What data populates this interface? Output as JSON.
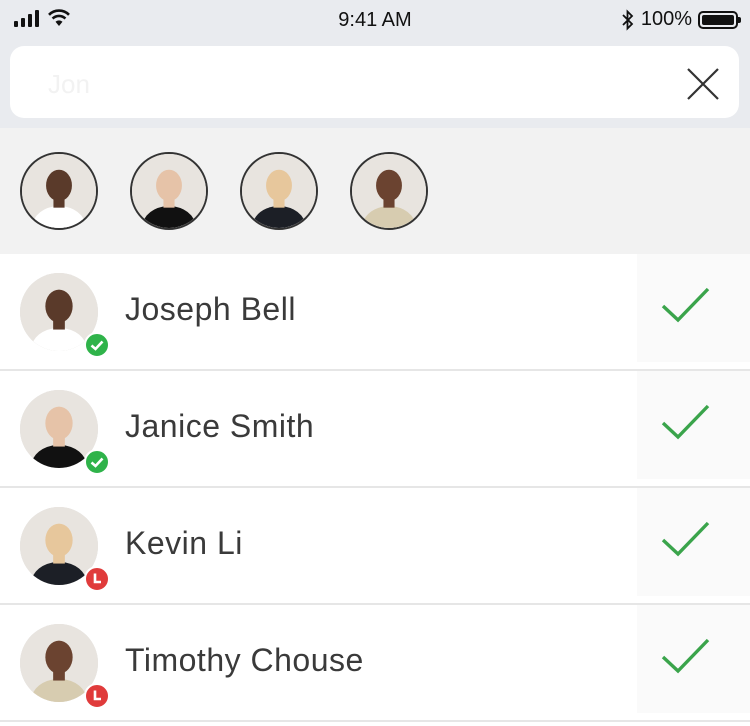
{
  "status_bar": {
    "time": "9:41 AM",
    "battery_percent_label": "100%",
    "battery_level": 1.0
  },
  "search": {
    "value": "Jon",
    "placeholder": ""
  },
  "selected_contacts": [
    {
      "name": "Joseph Bell",
      "skin": "#5a3a2a",
      "shirt": "#ffffff"
    },
    {
      "name": "Janice Smith",
      "skin": "#e6c3a8",
      "shirt": "#111111"
    },
    {
      "name": "Kevin Li",
      "skin": "#e7c79c",
      "shirt": "#1c1f26"
    },
    {
      "name": "Timothy Chouse",
      "skin": "#6b4330",
      "shirt": "#d7ccb0"
    }
  ],
  "contacts": [
    {
      "name": "Joseph Bell",
      "status": "available",
      "status_color": "#2fb34a",
      "selected": true
    },
    {
      "name": "Janice Smith",
      "status": "available",
      "status_color": "#2fb34a",
      "selected": true
    },
    {
      "name": "Kevin Li",
      "status": "away",
      "status_color": "#e03b3b",
      "selected": true
    },
    {
      "name": "Timothy Chouse",
      "status": "away",
      "status_color": "#e03b3b",
      "selected": true
    }
  ],
  "colors": {
    "check": "#3aa44b",
    "available": "#2fb34a",
    "away": "#e03b3b"
  },
  "icons": {
    "signal": "signal-icon",
    "wifi": "wifi-icon",
    "bluetooth": "bluetooth-icon",
    "battery": "battery-icon",
    "clear": "close-icon",
    "check": "checkmark-icon"
  }
}
